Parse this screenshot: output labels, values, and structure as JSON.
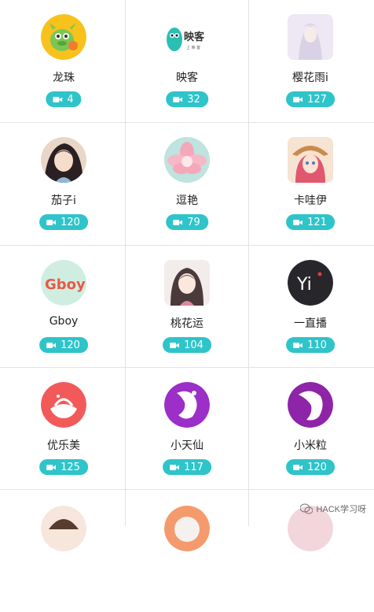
{
  "colors": {
    "badge": "#2ec4c9",
    "divider": "#e3e3e3"
  },
  "badge_icon": "video-camera-icon",
  "streamers": [
    {
      "name": "龙珠",
      "count": "4"
    },
    {
      "name": "映客",
      "count": "32"
    },
    {
      "name": "樱花雨i",
      "count": "127"
    },
    {
      "name": "茄子i",
      "count": "120"
    },
    {
      "name": "逗艳",
      "count": "79"
    },
    {
      "name": "卡哇伊",
      "count": "121"
    },
    {
      "name": "Gboy",
      "count": "120"
    },
    {
      "name": "桃花运",
      "count": "104"
    },
    {
      "name": "一直播",
      "count": "110"
    },
    {
      "name": "优乐美",
      "count": "125"
    },
    {
      "name": "小天仙",
      "count": "117"
    },
    {
      "name": "小米粒",
      "count": "120"
    },
    {
      "name": "",
      "count": ""
    },
    {
      "name": "",
      "count": ""
    },
    {
      "name": "",
      "count": ""
    }
  ],
  "logos": {
    "yingke": "映客",
    "yingke_sub": "上 映 客",
    "gboy": "Gboy",
    "yizhibo": "Yi"
  },
  "watermark": {
    "icon": "wechat-icon",
    "text": "HACK学习呀"
  }
}
